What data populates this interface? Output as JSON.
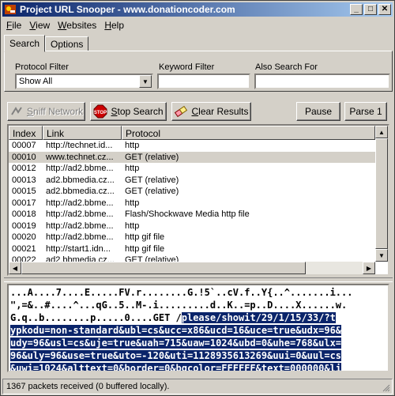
{
  "window": {
    "title": "Project URL Snooper - www.donationcoder.com",
    "controls": [
      "_",
      "□",
      "✕"
    ]
  },
  "menu": [
    {
      "first": "F",
      "rest": "ile"
    },
    {
      "first": "V",
      "rest": "iew"
    },
    {
      "first": "W",
      "rest": "ebsites"
    },
    {
      "first": "H",
      "rest": "elp"
    }
  ],
  "tabs": {
    "search": "Search",
    "options": "Options"
  },
  "filters": {
    "protocol_label": "Protocol Filter",
    "protocol_value": "Show All",
    "keyword_label": "Keyword Filter",
    "keyword_value": "",
    "also_label": "Also Search For",
    "also_value": ""
  },
  "buttons": {
    "sniff_first": "S",
    "sniff_rest": "niff Network",
    "stop_first": "S",
    "stop_rest": "top Search",
    "clear_first": "C",
    "clear_rest": "lear Results",
    "pause": "Pause",
    "parse": "Parse 1"
  },
  "table": {
    "headers": [
      "Index",
      "Link",
      "Protocol"
    ],
    "rows": [
      {
        "index": "00007",
        "link": "http://technet.id...",
        "protocol": "http",
        "selected": false
      },
      {
        "index": "00010",
        "link": "www.technet.cz...",
        "protocol": "GET (relative)",
        "selected": true
      },
      {
        "index": "00012",
        "link": "http://ad2.bbme...",
        "protocol": "http",
        "selected": false
      },
      {
        "index": "00013",
        "link": "ad2.bbmedia.cz...",
        "protocol": "GET (relative)",
        "selected": false
      },
      {
        "index": "00015",
        "link": "ad2.bbmedia.cz...",
        "protocol": "GET (relative)",
        "selected": false
      },
      {
        "index": "00017",
        "link": "http://ad2.bbme...",
        "protocol": "http",
        "selected": false
      },
      {
        "index": "00018",
        "link": "http://ad2.bbme...",
        "protocol": "Flash/Shockwave Media http file",
        "selected": false
      },
      {
        "index": "00019",
        "link": "http://ad2.bbme...",
        "protocol": "http",
        "selected": false
      },
      {
        "index": "00020",
        "link": "http://ad2.bbme...",
        "protocol": "http gif file",
        "selected": false
      },
      {
        "index": "00021",
        "link": "http://start1.idn...",
        "protocol": "http gif file",
        "selected": false
      },
      {
        "index": "00022",
        "link": "ad2.bbmedia.cz...",
        "protocol": "GET (relative)",
        "selected": false
      }
    ]
  },
  "dump": {
    "line1": "...A....7....E.....FV.r........G.!5`..cV.f..Y{..^.......i...",
    "line2": "\",=&..#....^...qG..5..M-.i.........d..K..=p..D....X......w.",
    "line3_plain": "G.q..b........p.....0....GET /",
    "line3_hl": "please/showit/29/1/15/33/?t",
    "line4": "ypkodu=non-standard&ubl=cs&ucc=x86&ucd=16&uce=true&udx=96&",
    "line5": "udy=96&usl=cs&uje=true&uah=715&uaw=1024&ubd=0&uhe=768&ulx=",
    "line6": "96&uly=96&use=true&uto=-120&uti=1128935613269&uui=0&uul=cs",
    "line7": "&uwi=1024&alttext=0&border=0&bgcolor=FFFFFF&text=000000&li"
  },
  "status": {
    "text": "1367 packets received (0 buffered locally)."
  }
}
